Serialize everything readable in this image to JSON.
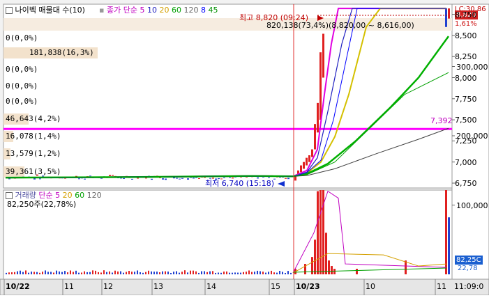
{
  "price_panel": {
    "checkbox_label": "나이벡 매물대 수(10)",
    "ma_label": "종가 단순 5",
    "ma_periods": [
      "10",
      "20",
      "60",
      "120",
      "8",
      "45"
    ],
    "ma_colors": [
      "#e100e1",
      "#2020c0",
      "#d4c000",
      "#00b000",
      "#404040",
      "#0000ff",
      "#00a000"
    ],
    "high_annotation": "최고 8,820 (09:24)",
    "low_annotation": "최저 6,740 (15:18)",
    "volume_profile_summary": "820,138(73,4%)(8,820,00 ~ 8,616,00)",
    "volume_profile_labels": [
      "0(0,0%)",
      "181,838(16,3%)",
      "0(0,0%)",
      "0(0,0%)",
      "0(0,0%)",
      "46,643(4,2%)",
      "16,078(1,4%)",
      "13,579(1,2%)",
      "39,361(3,5%)"
    ],
    "line_label": "7,392",
    "price_badge": "8,820",
    "change_badge": "1,61%",
    "lc_label": "LC:30,86",
    "y_ticks": [
      "8,750",
      "8,500",
      "8,250",
      "8,000",
      "7,750",
      "7,500",
      "7,250",
      "7,000",
      "6,750"
    ]
  },
  "volume_panel": {
    "label_prefix": "거래량",
    "ma_label": "단순 5",
    "ma_periods": [
      "20",
      "60",
      "120"
    ],
    "current_value": "82,250주(22,78%)",
    "badge": "82,25C",
    "badge_sub": "22,78",
    "y_ticks": [
      "300,000",
      "200,000",
      "100,000"
    ]
  },
  "x_axis": {
    "labels": [
      "10/22",
      "11",
      "12",
      "13",
      "14",
      "15",
      "10/23",
      "10",
      "11",
      "11:09:0"
    ]
  },
  "chart_data": {
    "type": "candlestick",
    "ylim": [
      6700,
      8900
    ],
    "y_ticks": [
      6750,
      7000,
      7250,
      7500,
      7750,
      8000,
      8250,
      8500,
      8750
    ],
    "high": 8820,
    "low": 6740,
    "horizontal_line": 7392,
    "current_price": 8820,
    "x_categories": [
      "10/22",
      "11",
      "12",
      "13",
      "14",
      "15",
      "10/23",
      "10",
      "11"
    ],
    "moving_averages": [
      {
        "name": "5",
        "color": "#e100e1"
      },
      {
        "name": "10",
        "color": "#2020c0"
      },
      {
        "name": "20",
        "color": "#d4c000"
      },
      {
        "name": "60",
        "color": "#00b000"
      },
      {
        "name": "120",
        "color": "#404040"
      },
      {
        "name": "8",
        "color": "#0000ff"
      },
      {
        "name": "45",
        "color": "#00a000"
      }
    ],
    "volume": {
      "ylim": [
        0,
        380000
      ],
      "y_ticks": [
        100000,
        200000,
        300000
      ],
      "current": 82250,
      "current_pct": 22.78,
      "max_value": 350000
    }
  }
}
